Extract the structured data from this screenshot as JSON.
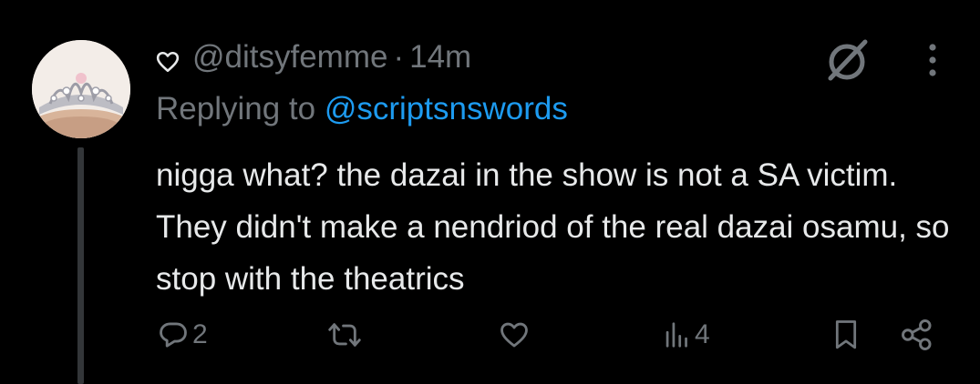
{
  "tweet": {
    "handle": "@ditsyfemme",
    "separator": "·",
    "time": "14m",
    "reply_prefix": "Replying to",
    "reply_to": "@scriptsnswords",
    "text": "nigga what? the dazai in the show is not a SA victim. They didn't make a nendriod of the real dazai osamu, so stop with the theatrics"
  },
  "actions": {
    "reply_count": "2",
    "retweet_count": "",
    "like_count": "",
    "views_count": "4"
  },
  "icons": {
    "heart": "heart-outline-icon",
    "grok": "grok-icon",
    "more": "more-vertical-icon",
    "reply": "reply-bubble-icon",
    "retweet": "retweet-icon",
    "like": "heart-icon",
    "views": "views-bar-icon",
    "bookmark": "bookmark-icon",
    "share": "share-icon"
  },
  "colors": {
    "background": "#000000",
    "text": "#e7e9ea",
    "muted": "#71767b",
    "link": "#1d9bf0",
    "thread_line": "#333639"
  }
}
